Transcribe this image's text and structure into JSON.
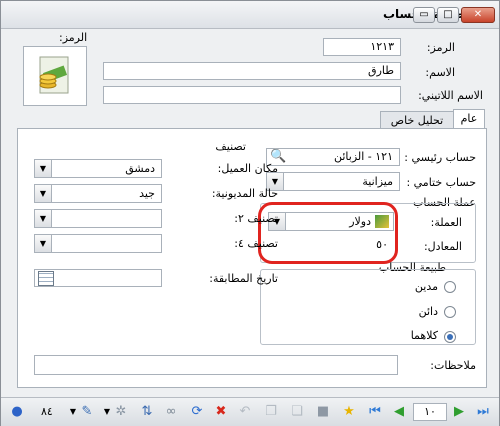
{
  "window": {
    "title": "بطاقة الحساب",
    "minimize": "▭",
    "maximize": "□",
    "close": "✕"
  },
  "header": {
    "code_label": "الرمز:",
    "code_value": "١٢١٣",
    "name_label": "الاسم:",
    "name_value": "طارق",
    "latin_name_label": "الاسم اللاتيني:",
    "latin_name_value": "",
    "image_code_label": "الرمز:"
  },
  "tabs": [
    {
      "label": "عام"
    },
    {
      "label": "تحليل خاص"
    }
  ],
  "general": {
    "main_account_label": "حساب رئيسي :",
    "main_account_value": "١٢١ - الزبائن",
    "final_account_label": "حساب ختامي :",
    "final_account_value": "ميزانية",
    "account_currency_legend": "عملة الحساب",
    "currency_label": "العملة:",
    "currency_value": "دولار",
    "rate_label": "المعادل:",
    "rate_value": "٥٠",
    "nature_legend": "طبيعة الحساب",
    "nature_options": [
      "مدين",
      "دائن",
      "كلاهما"
    ],
    "classification_legend": "تصنيف",
    "client_place_label": "مكان العميل:",
    "client_place_value": "دمشق",
    "debt_status_label": "حالة المديونية:",
    "debt_status_value": "جيد",
    "class2_label": "تصنيف ٢:",
    "class2_value": "",
    "class4_label": "تصنيف ٤:",
    "class4_value": "",
    "match_date_label": "تاريخ المطابقة:",
    "match_date_value": "",
    "notes_label": "ملاحظات:",
    "notes_value": ""
  },
  "toolbar": {
    "count_value": "٨٤",
    "record_value": "١٠"
  }
}
